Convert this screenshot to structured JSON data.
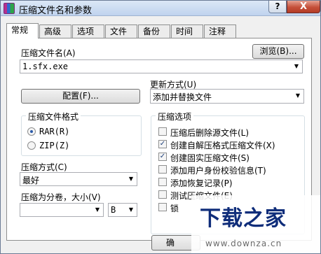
{
  "window": {
    "title": "压缩文件名和参数",
    "help_label": "?",
    "close_label": "X"
  },
  "tabs": [
    {
      "label": "常规",
      "active": true
    },
    {
      "label": "高级"
    },
    {
      "label": "选项"
    },
    {
      "label": "文件"
    },
    {
      "label": "备份"
    },
    {
      "label": "时间"
    },
    {
      "label": "注释"
    }
  ],
  "general": {
    "archive_name_label": "压缩文件名(A)",
    "browse_button": "浏览(B)...",
    "archive_name_value": "1.sfx.exe",
    "update_mode_label": "更新方式(U)",
    "update_mode_value": "添加并替换文件",
    "profiles_button": "配置(F)...",
    "format_group": {
      "title": "压缩文件格式",
      "options": [
        {
          "label": "RAR(R)",
          "selected": true
        },
        {
          "label": "ZIP(Z)",
          "selected": false
        }
      ]
    },
    "method_label": "压缩方式(C)",
    "method_value": "最好",
    "split_label": "压缩为分卷，大小(V)",
    "split_value": "",
    "split_unit_value": "B",
    "options_group": {
      "title": "压缩选项",
      "items": [
        {
          "label": "压缩后删除源文件(L)",
          "checked": false
        },
        {
          "label": "创建自解压格式压缩文件(X)",
          "checked": true
        },
        {
          "label": "创建固实压缩文件(S)",
          "checked": true
        },
        {
          "label": "添加用户身份校验信息(T)",
          "checked": false
        },
        {
          "label": "添加恢复记录(P)",
          "checked": false
        },
        {
          "label": "测试压缩文件(E)",
          "checked": false
        },
        {
          "label": "锁",
          "checked": false
        }
      ]
    }
  },
  "footer": {
    "ok_label": "确"
  },
  "watermark": {
    "brand": "下载之家",
    "url": "www.downza.cn"
  },
  "colors": {
    "accent": "#2a5aa8",
    "watermark_brand": "#0f2d7a",
    "close_button": "#c5503a"
  }
}
